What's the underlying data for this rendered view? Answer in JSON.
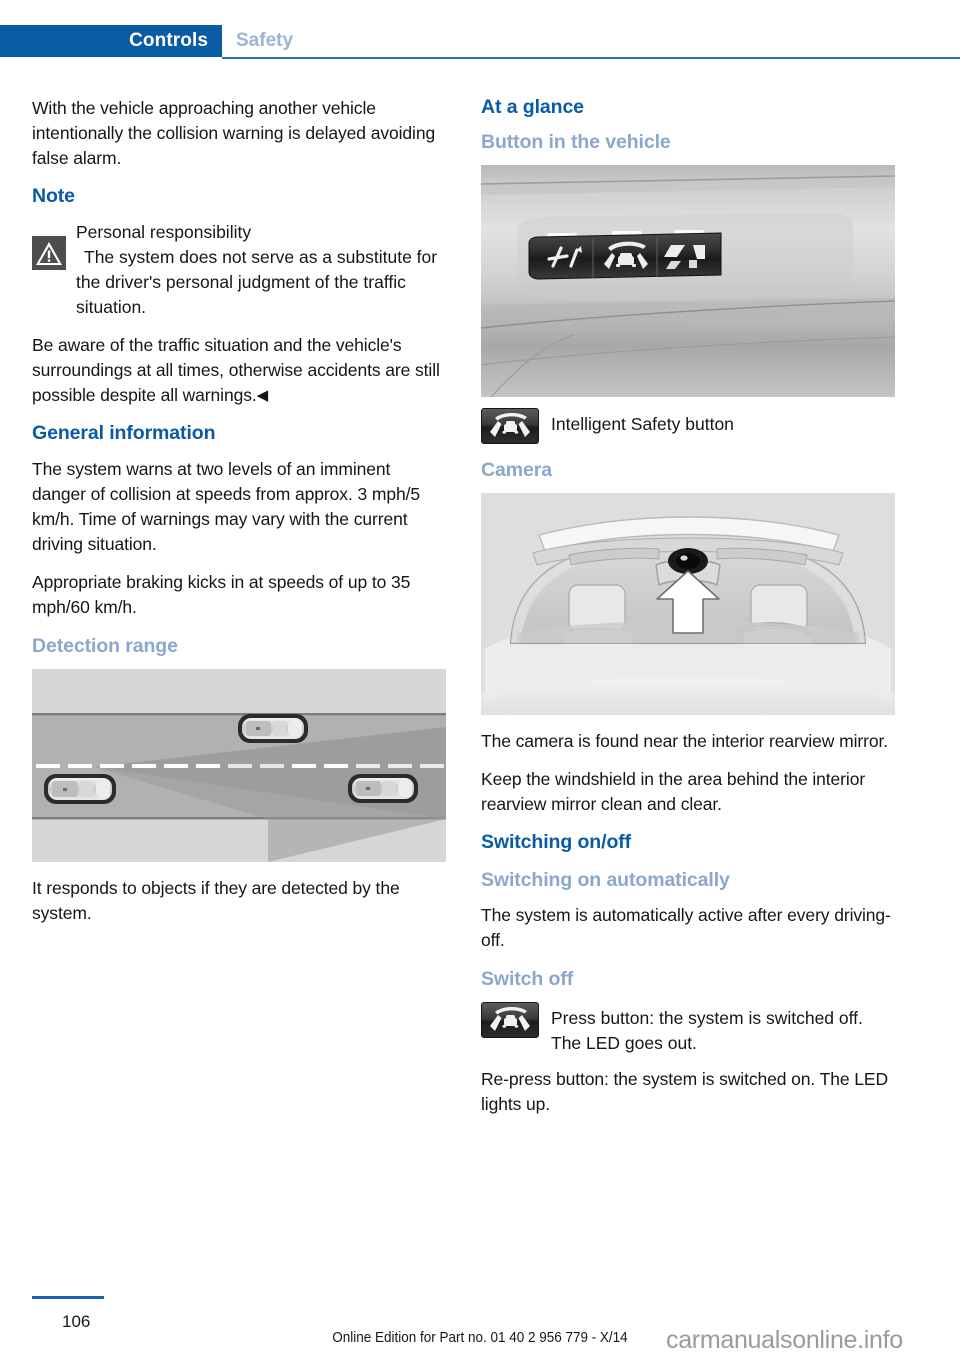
{
  "header": {
    "active_tab": "Controls",
    "inactive_tab": "Safety",
    "active_color": "#0a5ba5",
    "inactive_color": "#9db4d4"
  },
  "left_column": {
    "intro_paragraph": "With the vehicle approaching another vehicle intentionally the collision warning is delayed avoiding false alarm.",
    "note_heading": "Note",
    "note_icon": "warning-triangle-icon",
    "note_title": "Personal responsibility",
    "note_body_1": "The system does not serve as a substitute for the driver's personal judgment of the traffic situation.",
    "note_body_2": "Be aware of the traffic situation and the vehicle's surroundings at all times, otherwise accidents are still possible despite all warnings.",
    "note_end_marker": "◀",
    "general_heading": "General information",
    "general_para_1": "The system warns at two levels of an imminent danger of collision at speeds from approx. 3 mph/5 km/h. Time of warnings may vary with the current driving situation.",
    "general_para_2": "Appropriate braking kicks in at speeds of up to 35 mph/60 km/h.",
    "detection_heading": "Detection range",
    "detection_figure_name": "detection-range-diagram",
    "detection_caption": "It responds to objects if they are detected by the system."
  },
  "right_column": {
    "at_a_glance_heading": "At a glance",
    "button_in_vehicle_heading": "Button in the vehicle",
    "button_figure_name": "vehicle-button-panel-photo",
    "safety_button_icon": "intelligent-safety-button-icon",
    "safety_button_caption": "Intelligent Safety button",
    "camera_heading": "Camera",
    "camera_figure_name": "windshield-camera-location-photo",
    "camera_para_1": "The camera is found near the interior rearview mirror.",
    "camera_para_2": "Keep the windshield in the area behind the interior rearview mirror clean and clear.",
    "switching_heading": "Switching on/off",
    "switch_auto_heading": "Switching on automatically",
    "switch_auto_para": "The system is automatically active after every driving-off.",
    "switch_off_heading": "Switch off",
    "switch_off_icon": "intelligent-safety-button-icon",
    "switch_off_para": "Press button: the system is switched off. The LED goes out.",
    "switch_on_para": "Re-press button: the system is switched on. The LED lights up."
  },
  "footer": {
    "page_number": "106",
    "edition_note": "Online Edition for Part no. 01 40 2 956 779 - X/14",
    "watermark": "carmanualsonline.info"
  }
}
